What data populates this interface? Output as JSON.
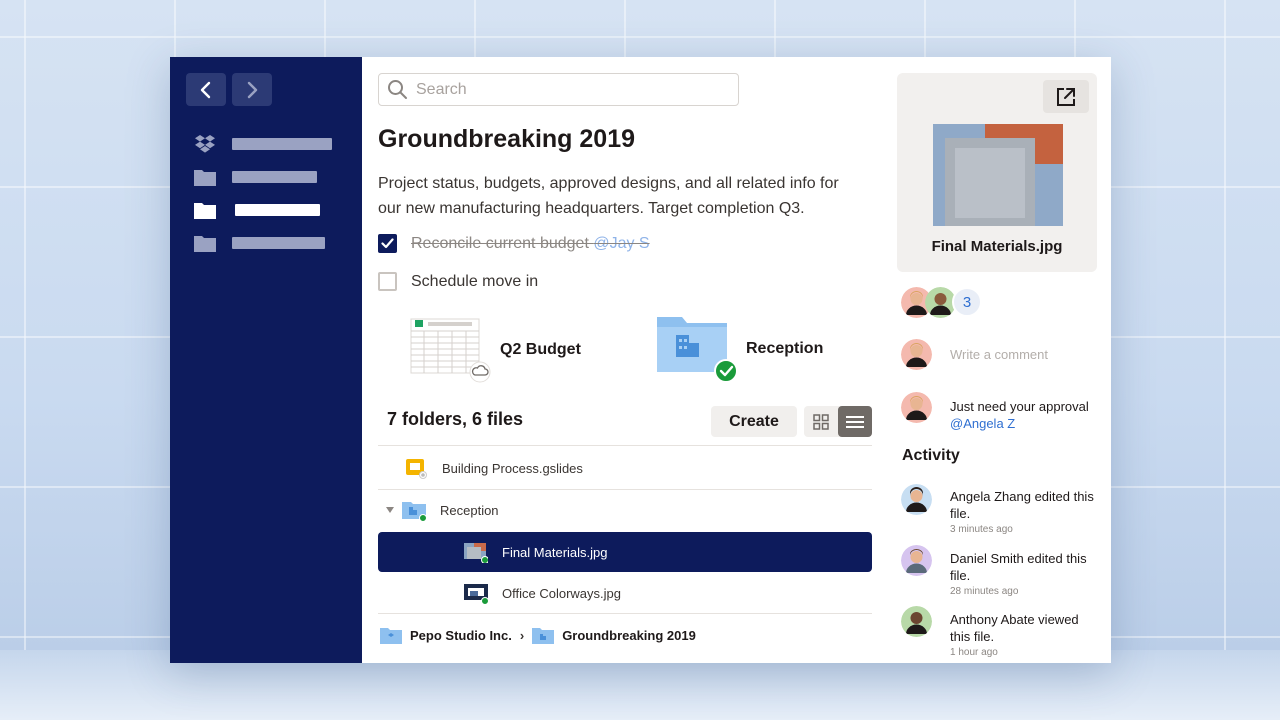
{
  "sidebar": {
    "back_icon": "chevron-left-icon",
    "forward_icon": "chevron-right-icon",
    "items": [
      {
        "icon": "dropbox-icon",
        "active": false
      },
      {
        "icon": "folder-icon",
        "active": false
      },
      {
        "icon": "folder-icon",
        "active": true
      },
      {
        "icon": "folder-icon",
        "active": false
      }
    ]
  },
  "search": {
    "placeholder": "Search"
  },
  "main": {
    "title": "Groundbreaking 2019",
    "description": "Project status, budgets, approved designs, and all related info for our new manufacturing headquarters. Target completion Q3.",
    "tasks": [
      {
        "text": "Reconcile current budget ",
        "mention": "@Jay S",
        "done": true
      },
      {
        "text": "Schedule move in",
        "done": false
      }
    ],
    "cards": [
      {
        "label": "Q2 Budget",
        "icon": "spreadsheet-icon"
      },
      {
        "label": "Reception",
        "icon": "folder-icon"
      }
    ],
    "summary": "7 folders, 6 files",
    "create_label": "Create",
    "files": [
      {
        "name": "Building Process.gslides",
        "icon": "slides-icon"
      },
      {
        "name": "Reception",
        "icon": "folder-icon"
      },
      {
        "name": "Final Materials.jpg",
        "icon": "image-icon"
      },
      {
        "name": "Office Colorways.jpg",
        "icon": "image-icon"
      }
    ],
    "breadcrumb": [
      "Pepo Studio Inc.",
      "Groundbreaking 2019"
    ]
  },
  "right": {
    "preview_name": "Final Materials.jpg",
    "shared_count": "3",
    "comment_placeholder": "Write a comment",
    "comment": {
      "text": "Just need your approval ",
      "mention": "@Angela Z"
    },
    "activity_title": "Activity",
    "activity": [
      {
        "text": "Angela Zhang edited this file.",
        "time": "3 minutes ago"
      },
      {
        "text": "Daniel Smith edited this file.",
        "time": "28 minutes ago"
      },
      {
        "text": "Anthony Abate viewed this file.",
        "time": "1 hour ago"
      }
    ]
  },
  "colors": {
    "navy": "#0d1b5c",
    "accent_blue": "#2f6fd1",
    "green_check": "#1a9b3a",
    "folder_blue": "#8ec0ef"
  }
}
